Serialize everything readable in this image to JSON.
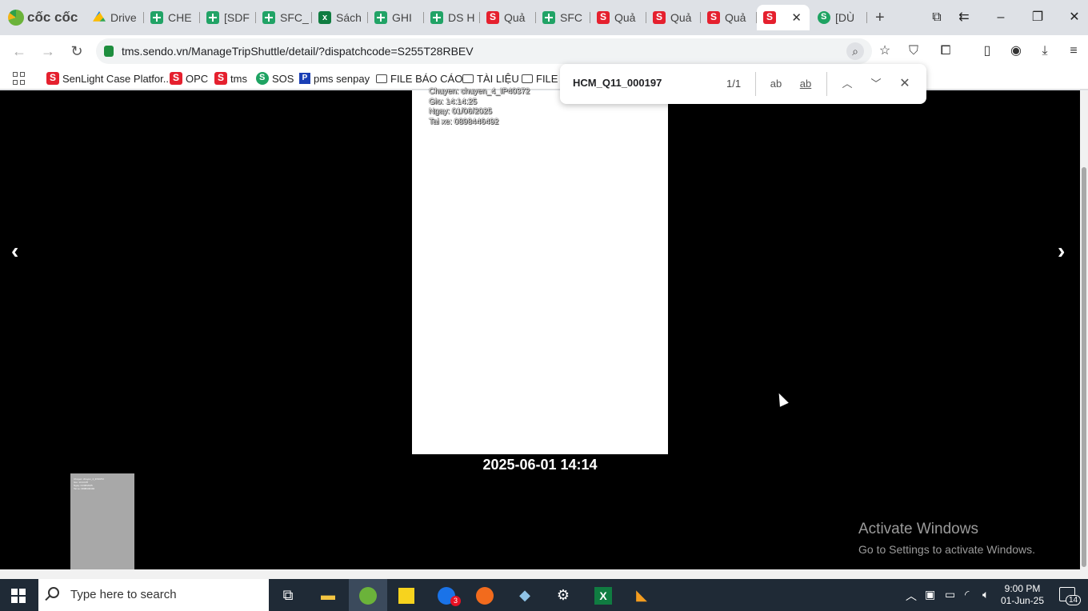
{
  "browser": {
    "brand": "cốc cốc",
    "tabs": [
      {
        "label": "Drive",
        "icon": "drive"
      },
      {
        "label": "CHE",
        "icon": "sheet"
      },
      {
        "label": "[SDF",
        "icon": "sheet"
      },
      {
        "label": "SFC_",
        "icon": "sheet"
      },
      {
        "label": "Sách",
        "icon": "excel"
      },
      {
        "label": "GHI",
        "icon": "sheet"
      },
      {
        "label": "DS H",
        "icon": "sheet"
      },
      {
        "label": "Quả",
        "icon": "sendo"
      },
      {
        "label": "SFC",
        "icon": "sheet"
      },
      {
        "label": "Quả",
        "icon": "sendo"
      },
      {
        "label": "Quả",
        "icon": "sendo"
      },
      {
        "label": "Quả",
        "icon": "sendo"
      },
      {
        "label": "",
        "icon": "sendo",
        "active": true
      },
      {
        "label": "[DÙ",
        "icon": "sos"
      }
    ],
    "url": "tms.sendo.vn/ManageTripShuttle/detail/?dispatchcode=S255T28RBEV"
  },
  "bookmarks": [
    {
      "label": "SenLight Case Platfor...",
      "icon": "sendo"
    },
    {
      "label": "OPC",
      "icon": "sendo"
    },
    {
      "label": "tms",
      "icon": "sendo"
    },
    {
      "label": "SOS",
      "icon": "sos"
    },
    {
      "label": "pms senpay",
      "icon": "pms"
    },
    {
      "label": "FILE BÁO CÁO",
      "icon": "folder"
    },
    {
      "label": "TÀI LIỆU",
      "icon": "folder"
    },
    {
      "label": "FILE C",
      "icon": "folder"
    }
  ],
  "find": {
    "query": "HCM_Q11_000197",
    "count": "1/1",
    "match_case": "ab",
    "whole_word": "ab"
  },
  "viewer": {
    "overlay_lines": [
      "Chuyen: chuyen_4_IP40372",
      "Gio: 14:14:25",
      "Ngay: 01/06/2025",
      "Tai xe: 0898446492"
    ],
    "timestamp": "2025-06-01 14:14",
    "prev": "‹",
    "next": "›"
  },
  "watermark": {
    "line1": "Activate Windows",
    "line2": "Go to Settings to activate Windows."
  },
  "taskbar": {
    "search_placeholder": "Type here to search",
    "zalo_badge": "3",
    "time": "9:00 PM",
    "date": "01-Jun-25",
    "notifications": "14"
  }
}
